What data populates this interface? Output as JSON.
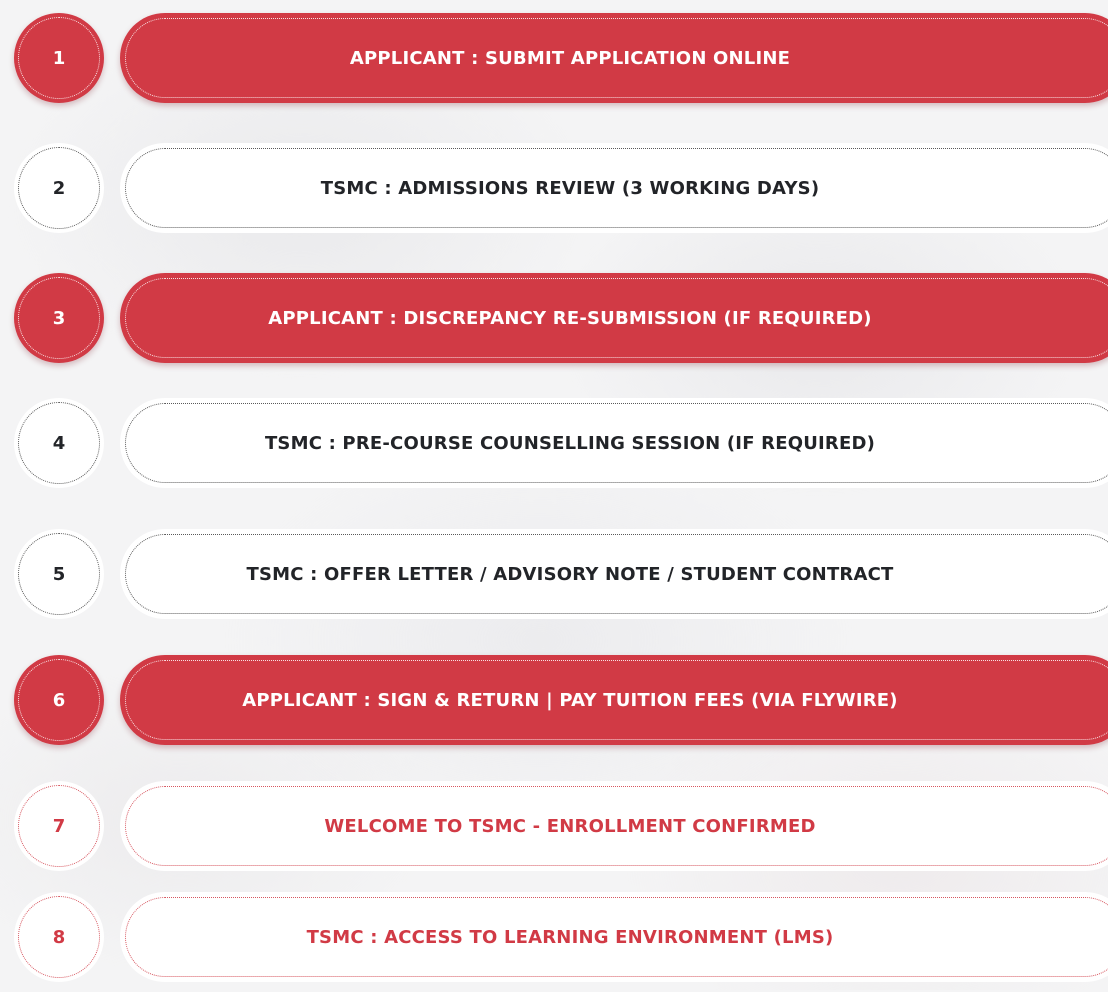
{
  "colors": {
    "accent": "#d13a45",
    "text_dark": "#222428",
    "white": "#ffffff"
  },
  "steps": [
    {
      "number": "1",
      "label": "APPLICANT : SUBMIT APPLICATION ONLINE",
      "style": "red"
    },
    {
      "number": "2",
      "label": "TSMC : ADMISSIONS REVIEW (3 WORKING DAYS)",
      "style": "white"
    },
    {
      "number": "3",
      "label": "APPLICANT : DISCREPANCY RE-SUBMISSION (IF REQUIRED)",
      "style": "red"
    },
    {
      "number": "4",
      "label": "TSMC : PRE-COURSE COUNSELLING SESSION (IF REQUIRED)",
      "style": "white"
    },
    {
      "number": "5",
      "label": "TSMC : OFFER LETTER / ADVISORY NOTE / STUDENT CONTRACT",
      "style": "white"
    },
    {
      "number": "6",
      "label": "APPLICANT : SIGN & RETURN | PAY TUITION FEES (VIA FLYWIRE)",
      "style": "red"
    },
    {
      "number": "7",
      "label": "WELCOME TO TSMC - ENROLLMENT CONFIRMED",
      "style": "whitered"
    },
    {
      "number": "8",
      "label": "TSMC : ACCESS TO LEARNING ENVIRONMENT (LMS)",
      "style": "whitered"
    }
  ]
}
